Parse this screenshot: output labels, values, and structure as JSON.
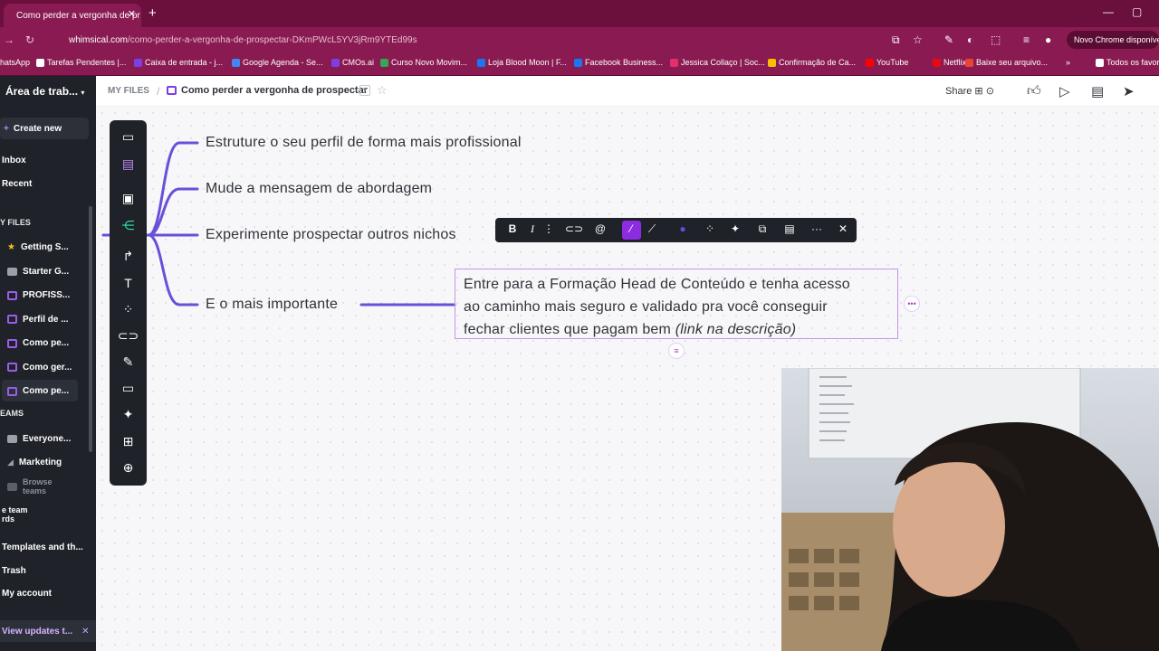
{
  "browser": {
    "tab_title": "Como perder a vergonha de pr",
    "url_host": "whimsical.com",
    "url_path": "/como-perder-a-vergonha-de-prospectar-DKmPWcL5YV3jRm9YTEd99s",
    "chrome_notice": "Novo Chrome disponível",
    "bookmarks": [
      {
        "label": "hatsApp",
        "color": "#25d366"
      },
      {
        "label": "Tarefas Pendentes |...",
        "color": "#ffffff"
      },
      {
        "label": "Caixa de entrada - j...",
        "color": "#7b3fe4"
      },
      {
        "label": "Google Agenda - Se...",
        "color": "#4285f4"
      },
      {
        "label": "CMOs.ai",
        "color": "#7b3fe4"
      },
      {
        "label": "Curso Novo Movim...",
        "color": "#34a853"
      },
      {
        "label": "Loja Blood Moon | F...",
        "color": "#1877f2"
      },
      {
        "label": "Facebook Business...",
        "color": "#1877f2"
      },
      {
        "label": "Jessica Collaço | Soc...",
        "color": "#e1306c"
      },
      {
        "label": "Confirmação de Ca...",
        "color": "#fbbc04"
      },
      {
        "label": "YouTube",
        "color": "#ff0000"
      },
      {
        "label": "Netflix",
        "color": "#e50914"
      },
      {
        "label": "Baixe seu arquivo...",
        "color": "#ea4335"
      },
      {
        "label": "Todos os favor",
        "color": "#ffffff"
      }
    ]
  },
  "sidebar": {
    "workspace": "Área de trab...",
    "create_new": "Create new",
    "inbox": "Inbox",
    "recent": "Recent",
    "my_files_section": "Y FILES",
    "files": [
      {
        "label": "Getting S...",
        "type": "star"
      },
      {
        "label": "Starter G...",
        "type": "folder"
      },
      {
        "label": "PROFISS...",
        "type": "board"
      },
      {
        "label": "Perfil de ...",
        "type": "board"
      },
      {
        "label": "Como pe...",
        "type": "board"
      },
      {
        "label": "Como ger...",
        "type": "board"
      },
      {
        "label": "Como pe...",
        "type": "board"
      }
    ],
    "teams_section": "EAMS",
    "teams": [
      {
        "label": "Everyone..."
      },
      {
        "label": "Marketing"
      }
    ],
    "browse_teams": "Browse teams",
    "team_boards_line1": "e team",
    "team_boards_line2": "rds",
    "templates": "Templates and th...",
    "trash": "Trash",
    "account": "My account",
    "view_updates": "View updates t..."
  },
  "header": {
    "root": "MY FILES",
    "doc_title": "Como perder a vergonha de prospectar",
    "share": "Share"
  },
  "mindmap": {
    "branches": [
      "Estruture o seu perfil de forma mais profissional",
      "Mude a mensagem de abordagem",
      "Experimente prospectar outros nichos",
      "E o mais importante"
    ],
    "selected_card": {
      "line1": "Entre para a Formação Head de Conteúdo e tenha acesso",
      "line2": "ao caminho mais seguro e validado pra você conseguir",
      "line3": "fechar clientes que pagam bem",
      "italic": "(link na descrição)"
    }
  },
  "format_toolbar": {
    "bold": "B",
    "italic": "I",
    "close": "✕",
    "more": "···"
  },
  "colors": {
    "brand_tab": "#6b0f3c",
    "brand_bar": "#8a1b52",
    "sidebar_bg": "#1f2229",
    "accent_purple": "#8b2be2",
    "connector": "#6a4fd8"
  }
}
